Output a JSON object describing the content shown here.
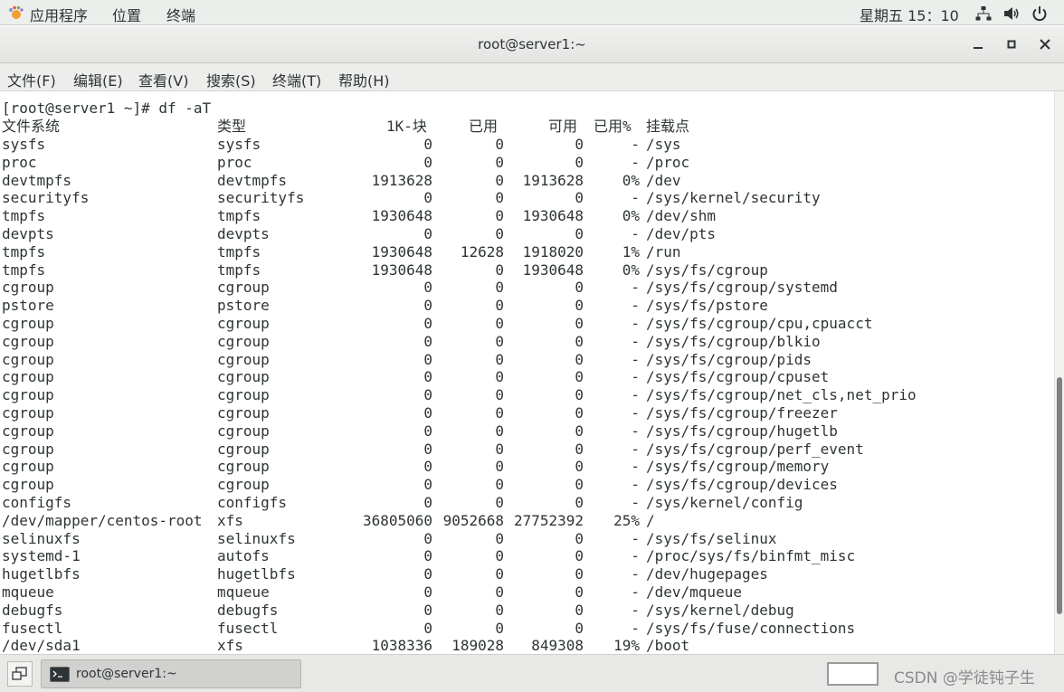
{
  "topbar": {
    "menus": [
      "应用程序",
      "位置",
      "终端"
    ],
    "clock": "星期五 15：10"
  },
  "window": {
    "title": "root@server1:~",
    "menu": [
      "文件(F)",
      "编辑(E)",
      "查看(V)",
      "搜索(S)",
      "终端(T)",
      "帮助(H)"
    ]
  },
  "terminal": {
    "prompt": "[root@server1 ~]# df -aT",
    "headers": [
      "文件系统",
      "类型",
      "1K-块",
      "已用",
      "可用",
      "已用%",
      "挂载点"
    ],
    "rows": [
      [
        "sysfs",
        "sysfs",
        "0",
        "0",
        "0",
        "-",
        "/sys"
      ],
      [
        "proc",
        "proc",
        "0",
        "0",
        "0",
        "-",
        "/proc"
      ],
      [
        "devtmpfs",
        "devtmpfs",
        "1913628",
        "0",
        "1913628",
        "0%",
        "/dev"
      ],
      [
        "securityfs",
        "securityfs",
        "0",
        "0",
        "0",
        "-",
        "/sys/kernel/security"
      ],
      [
        "tmpfs",
        "tmpfs",
        "1930648",
        "0",
        "1930648",
        "0%",
        "/dev/shm"
      ],
      [
        "devpts",
        "devpts",
        "0",
        "0",
        "0",
        "-",
        "/dev/pts"
      ],
      [
        "tmpfs",
        "tmpfs",
        "1930648",
        "12628",
        "1918020",
        "1%",
        "/run"
      ],
      [
        "tmpfs",
        "tmpfs",
        "1930648",
        "0",
        "1930648",
        "0%",
        "/sys/fs/cgroup"
      ],
      [
        "cgroup",
        "cgroup",
        "0",
        "0",
        "0",
        "-",
        "/sys/fs/cgroup/systemd"
      ],
      [
        "pstore",
        "pstore",
        "0",
        "0",
        "0",
        "-",
        "/sys/fs/pstore"
      ],
      [
        "cgroup",
        "cgroup",
        "0",
        "0",
        "0",
        "-",
        "/sys/fs/cgroup/cpu,cpuacct"
      ],
      [
        "cgroup",
        "cgroup",
        "0",
        "0",
        "0",
        "-",
        "/sys/fs/cgroup/blkio"
      ],
      [
        "cgroup",
        "cgroup",
        "0",
        "0",
        "0",
        "-",
        "/sys/fs/cgroup/pids"
      ],
      [
        "cgroup",
        "cgroup",
        "0",
        "0",
        "0",
        "-",
        "/sys/fs/cgroup/cpuset"
      ],
      [
        "cgroup",
        "cgroup",
        "0",
        "0",
        "0",
        "-",
        "/sys/fs/cgroup/net_cls,net_prio"
      ],
      [
        "cgroup",
        "cgroup",
        "0",
        "0",
        "0",
        "-",
        "/sys/fs/cgroup/freezer"
      ],
      [
        "cgroup",
        "cgroup",
        "0",
        "0",
        "0",
        "-",
        "/sys/fs/cgroup/hugetlb"
      ],
      [
        "cgroup",
        "cgroup",
        "0",
        "0",
        "0",
        "-",
        "/sys/fs/cgroup/perf_event"
      ],
      [
        "cgroup",
        "cgroup",
        "0",
        "0",
        "0",
        "-",
        "/sys/fs/cgroup/memory"
      ],
      [
        "cgroup",
        "cgroup",
        "0",
        "0",
        "0",
        "-",
        "/sys/fs/cgroup/devices"
      ],
      [
        "configfs",
        "configfs",
        "0",
        "0",
        "0",
        "-",
        "/sys/kernel/config"
      ],
      [
        "/dev/mapper/centos-root",
        "xfs",
        "36805060",
        "9052668",
        "27752392",
        "25%",
        "/"
      ],
      [
        "selinuxfs",
        "selinuxfs",
        "0",
        "0",
        "0",
        "-",
        "/sys/fs/selinux"
      ],
      [
        "systemd-1",
        "autofs",
        "0",
        "0",
        "0",
        "-",
        "/proc/sys/fs/binfmt_misc"
      ],
      [
        "hugetlbfs",
        "hugetlbfs",
        "0",
        "0",
        "0",
        "-",
        "/dev/hugepages"
      ],
      [
        "mqueue",
        "mqueue",
        "0",
        "0",
        "0",
        "-",
        "/dev/mqueue"
      ],
      [
        "debugfs",
        "debugfs",
        "0",
        "0",
        "0",
        "-",
        "/sys/kernel/debug"
      ],
      [
        "fusectl",
        "fusectl",
        "0",
        "0",
        "0",
        "-",
        "/sys/fs/fuse/connections"
      ],
      [
        "/dev/sda1",
        "xfs",
        "1038336",
        "189028",
        "849308",
        "19%",
        "/boot"
      ]
    ]
  },
  "taskbar": {
    "task_label": "root@server1:~",
    "watermark": "CSDN @学徒钝子生"
  },
  "icons": {
    "apps": "gnome-foot-icon",
    "network": "network-icon",
    "volume": "volume-icon",
    "power": "power-icon",
    "minimize": "minimize-icon",
    "maximize": "maximize-icon",
    "close": "close-icon",
    "show_desktop": "show-desktop-icon",
    "terminal": "terminal-icon"
  }
}
